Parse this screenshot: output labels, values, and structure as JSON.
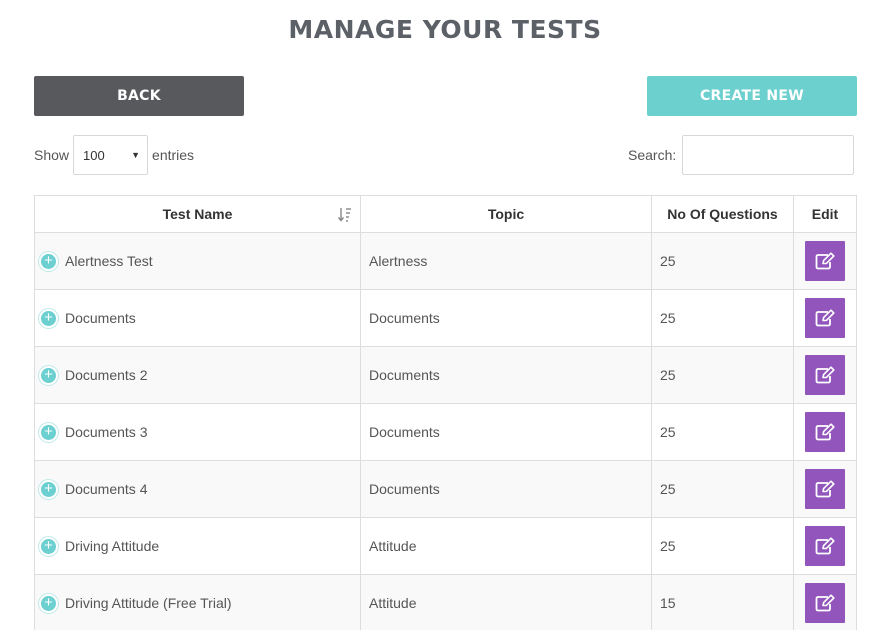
{
  "page": {
    "title": "MANAGE YOUR TESTS"
  },
  "toolbar": {
    "back_label": "BACK",
    "create_label": "CREATE NEW"
  },
  "length_control": {
    "show_label": "Show",
    "selected": "100",
    "entries_label": "entries"
  },
  "search": {
    "label": "Search:",
    "value": ""
  },
  "table": {
    "headers": {
      "name": "Test Name",
      "topic": "Topic",
      "questions": "No Of Questions",
      "edit": "Edit"
    },
    "rows": [
      {
        "name": "Alertness Test",
        "topic": "Alertness",
        "questions": "25"
      },
      {
        "name": "Documents",
        "topic": "Documents",
        "questions": "25"
      },
      {
        "name": "Documents 2",
        "topic": "Documents",
        "questions": "25"
      },
      {
        "name": "Documents 3",
        "topic": "Documents",
        "questions": "25"
      },
      {
        "name": "Documents 4",
        "topic": "Documents",
        "questions": "25"
      },
      {
        "name": "Driving Attitude",
        "topic": "Attitude",
        "questions": "25"
      },
      {
        "name": "Driving Attitude (Free Trial)",
        "topic": "Attitude",
        "questions": "15"
      }
    ]
  },
  "icons": {
    "sort": "sort-descending-icon",
    "expand": "plus-circle-icon",
    "edit": "edit-pencil-icon"
  },
  "colors": {
    "back_button": "#57595d",
    "create_button": "#6cd0cf",
    "edit_button": "#9155bb",
    "expand_icon": "#6ccfd0"
  }
}
